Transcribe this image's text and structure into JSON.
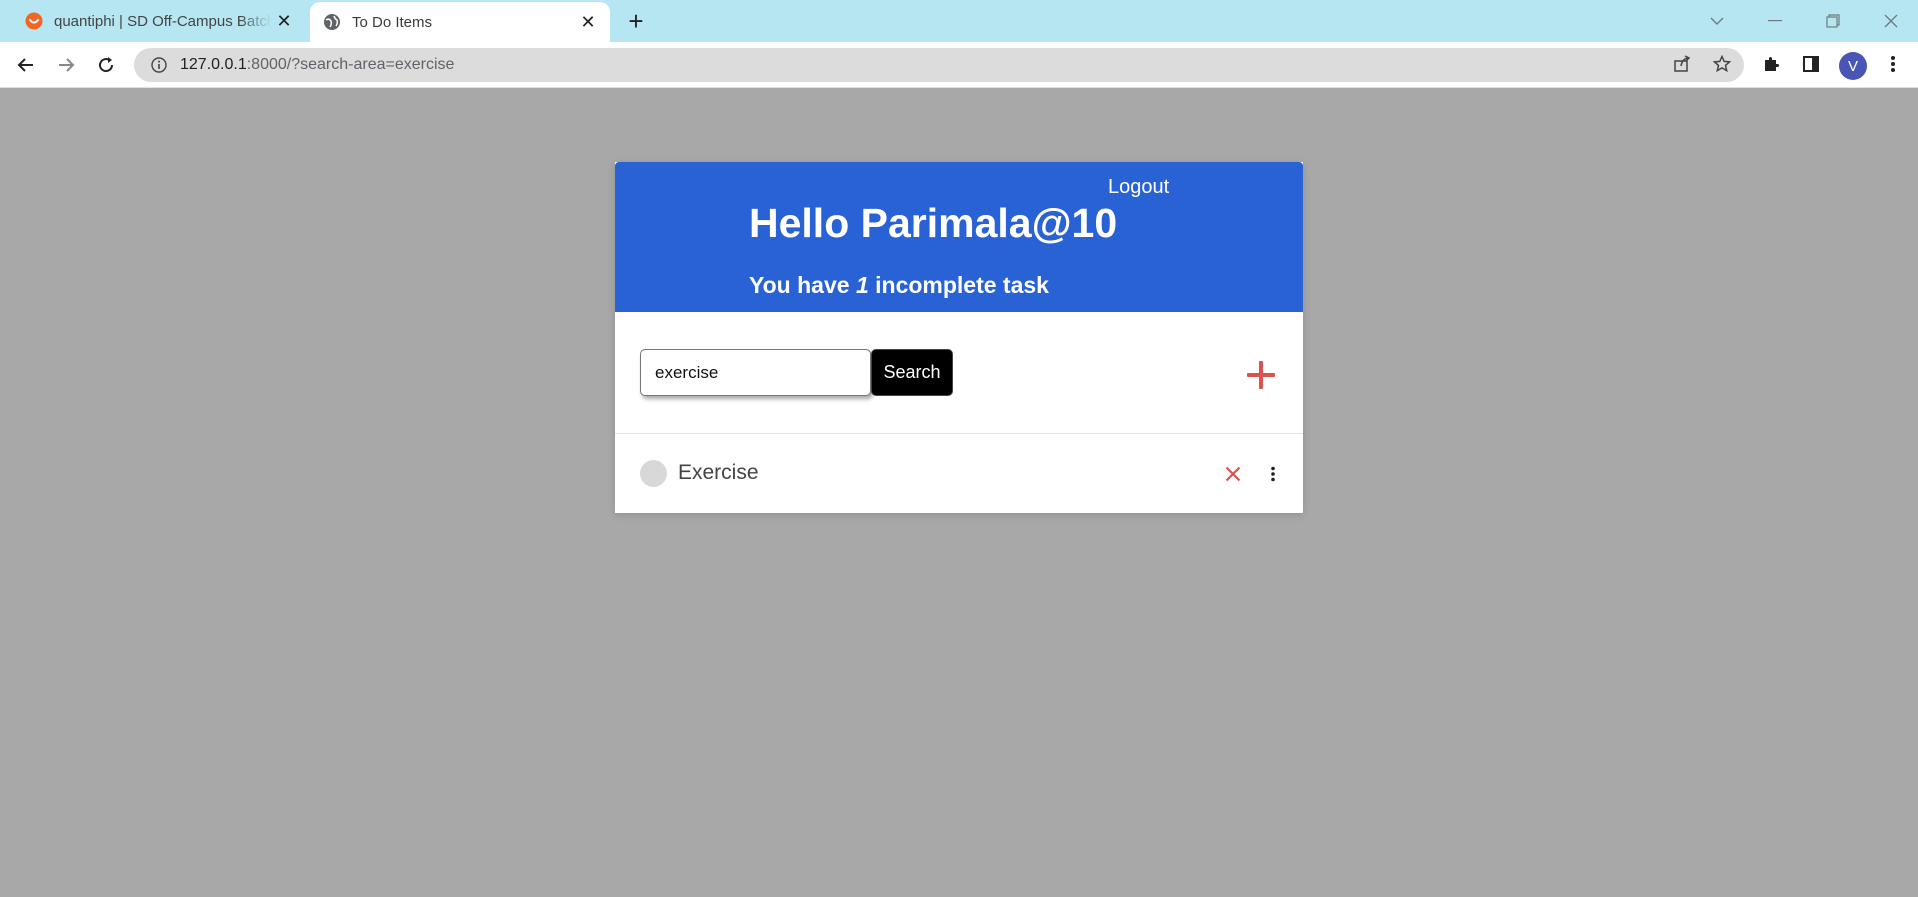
{
  "browser": {
    "tabs": [
      {
        "title": "quantiphi | SD Off-Campus Batch",
        "active": false,
        "icon": "brand-favicon-icon"
      },
      {
        "title": "To Do Items",
        "active": true,
        "icon": "globe-icon"
      }
    ],
    "close_glyph": "✕",
    "new_tab_glyph": "+",
    "url_host": "127.0.0.1",
    "url_path": ":8000/?search-area=exercise",
    "profile_initial": "V"
  },
  "app": {
    "logout_label": "Logout",
    "greeting": "Hello Parimala@10",
    "task_count_prefix": "You have ",
    "task_count_value": "1",
    "task_count_suffix": " incomplete task",
    "search": {
      "value": "exercise",
      "button_label": "Search"
    },
    "add_icon": "plus-icon",
    "tasks": [
      {
        "title": "Exercise",
        "complete": false
      }
    ]
  },
  "colors": {
    "header_blue": "#2962d4",
    "page_bg": "#a9a8a9",
    "tab_strip": "#b5e6f1",
    "accent_red": "#d9534f"
  }
}
